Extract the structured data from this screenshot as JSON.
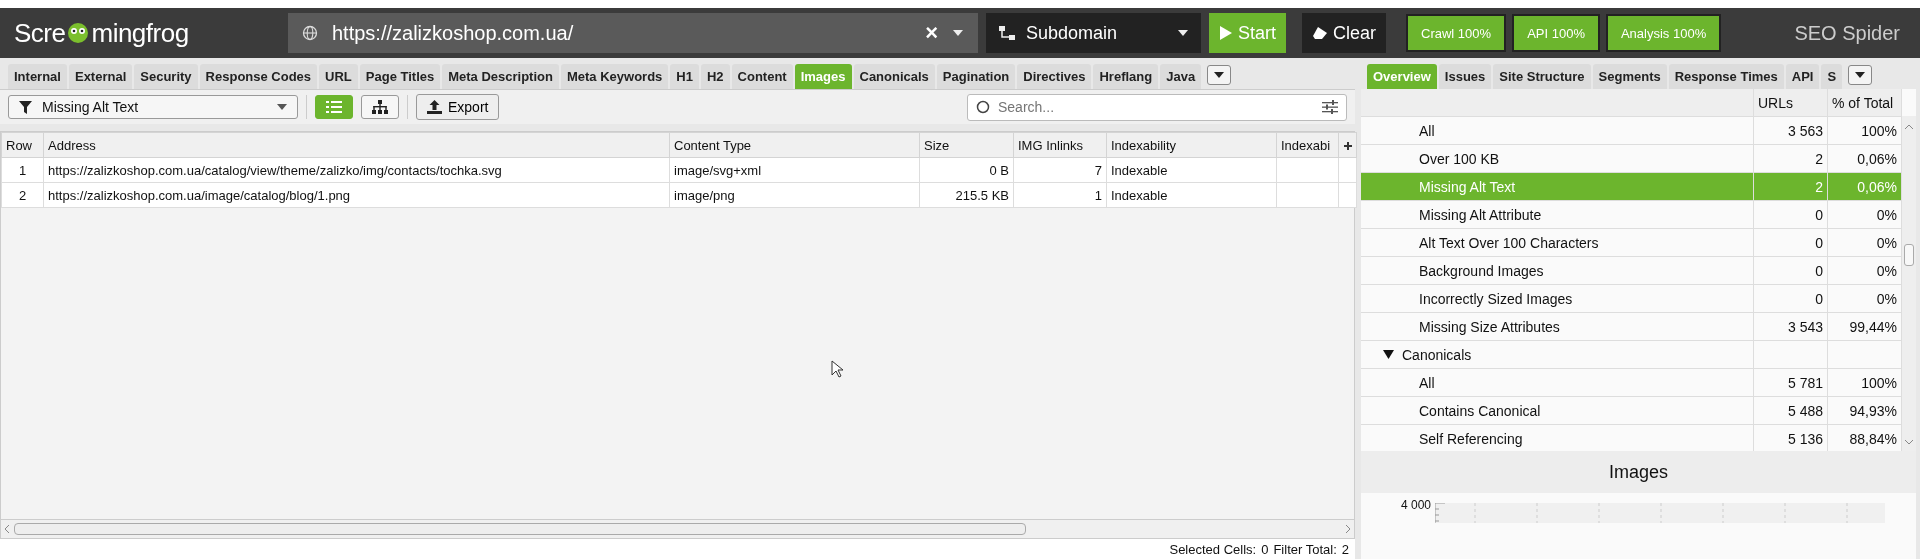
{
  "header": {
    "logo_left": "Scre",
    "logo_right": "mingfrog",
    "url": "https://zalizkoshop.com.ua/",
    "clear_symbol": "×",
    "mode": "Subdomain",
    "start": "Start",
    "clear": "Clear",
    "badges": [
      {
        "label": "Crawl 100%"
      },
      {
        "label": "API 100%"
      },
      {
        "label": "Analysis 100%"
      }
    ],
    "product": "SEO Spider"
  },
  "tabs": [
    {
      "label": "Internal",
      "selected": false
    },
    {
      "label": "External",
      "selected": false
    },
    {
      "label": "Security",
      "selected": false
    },
    {
      "label": "Response Codes",
      "selected": false
    },
    {
      "label": "URL",
      "selected": false
    },
    {
      "label": "Page Titles",
      "selected": false
    },
    {
      "label": "Meta Description",
      "selected": false
    },
    {
      "label": "Meta Keywords",
      "selected": false
    },
    {
      "label": "H1",
      "selected": false
    },
    {
      "label": "H2",
      "selected": false
    },
    {
      "label": "Content",
      "selected": false
    },
    {
      "label": "Images",
      "selected": true
    },
    {
      "label": "Canonicals",
      "selected": false
    },
    {
      "label": "Pagination",
      "selected": false
    },
    {
      "label": "Directives",
      "selected": false
    },
    {
      "label": "Hreflang",
      "selected": false
    },
    {
      "label": "Java",
      "selected": false
    }
  ],
  "toolbar": {
    "filter": "Missing Alt Text",
    "views": [
      {
        "kind": "list",
        "selected": true
      },
      {
        "kind": "tree",
        "selected": false
      }
    ],
    "export": "Export",
    "search": {
      "placeholder": "Search..."
    }
  },
  "table": {
    "columns": [
      "Row",
      "Address",
      "Content Type",
      "Size",
      "IMG Inlinks",
      "Indexability",
      "Indexabi"
    ],
    "rows": [
      [
        "1",
        "https://zalizkoshop.com.ua/catalog/view/theme/zalizko/img/contacts/tochka.svg",
        "image/svg+xml",
        "0 B",
        "7",
        "Indexable",
        ""
      ],
      [
        "2",
        "https://zalizkoshop.com.ua/image/catalog/blog/1.png",
        "image/png",
        "215.5 KB",
        "1",
        "Indexable",
        ""
      ]
    ]
  },
  "status_bar": {
    "selected_label": "Selected Cells:",
    "selected_value": "0",
    "filter_label": "Filter Total:",
    "filter_value": "2"
  },
  "right_tabs": [
    {
      "label": "Overview",
      "selected": true
    },
    {
      "label": "Issues",
      "selected": false
    },
    {
      "label": "Site Structure",
      "selected": false
    },
    {
      "label": "Segments",
      "selected": false
    },
    {
      "label": "Response Times",
      "selected": false
    },
    {
      "label": "API",
      "selected": false
    },
    {
      "label": "S",
      "selected": false
    }
  ],
  "overview": {
    "columns": [
      "URLs",
      "% of Total"
    ],
    "groups": [
      {
        "children": [
          {
            "label": "All",
            "urls": "3 563",
            "percent": "100%",
            "selected": false
          },
          {
            "label": "Over 100 KB",
            "urls": "2",
            "percent": "0,06%",
            "selected": false
          },
          {
            "label": "Missing Alt Text",
            "urls": "2",
            "percent": "0,06%",
            "selected": true
          },
          {
            "label": "Missing Alt Attribute",
            "urls": "0",
            "percent": "0%",
            "selected": false
          },
          {
            "label": "Alt Text Over 100 Characters",
            "urls": "0",
            "percent": "0%",
            "selected": false
          },
          {
            "label": "Background Images",
            "urls": "0",
            "percent": "0%",
            "selected": false
          },
          {
            "label": "Incorrectly Sized Images",
            "urls": "0",
            "percent": "0%",
            "selected": false
          },
          {
            "label": "Missing Size Attributes",
            "urls": "3 543",
            "percent": "99,44%",
            "selected": false
          }
        ]
      },
      {
        "label": "Canonicals",
        "expanded": true,
        "children": [
          {
            "label": "All",
            "urls": "5 781",
            "percent": "100%",
            "selected": false
          },
          {
            "label": "Contains Canonical",
            "urls": "5 488",
            "percent": "94,93%",
            "selected": false
          },
          {
            "label": "Self Referencing",
            "urls": "5 136",
            "percent": "88,84%",
            "selected": false
          }
        ]
      }
    ]
  },
  "chart": {
    "title": "Images",
    "tick": "4 000"
  }
}
